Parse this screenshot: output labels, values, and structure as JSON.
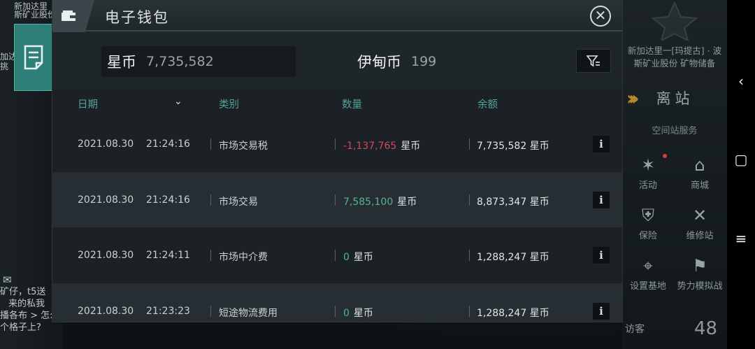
{
  "background": {
    "left_texts": [
      "新加达里",
      "斯矿业股份",
      "加达",
      "挑"
    ],
    "station": {
      "name_line1": "新加达里一[玛提古] · 波",
      "name_line2": "斯矿业股份 矿物储备",
      "undock_label": "离站",
      "services_title": "空间站服务",
      "services": [
        {
          "label": "活动",
          "icon": "party-popper-icon"
        },
        {
          "label": "商城",
          "icon": "shop-icon"
        },
        {
          "label": "保险",
          "icon": "insurance-icon"
        },
        {
          "label": "维修站",
          "icon": "repair-icon"
        },
        {
          "label": "设置基地",
          "icon": "base-icon"
        },
        {
          "label": "势力模拟战",
          "icon": "faction-battle-icon"
        }
      ],
      "visitor_label": "访客",
      "visitor_count": "48"
    },
    "chat": {
      "line1": "矿仔，t5送",
      "line2": "来的私我",
      "line3": "播各布 > 怎么就吧炮放在一起，无人",
      "line4": "个格子上?"
    }
  },
  "wallet": {
    "title": "电子钱包",
    "balances": {
      "star_label": "星币",
      "star_value": "7,735,582",
      "isk_label": "伊甸币",
      "isk_value": "199"
    },
    "columns": {
      "date": "日期",
      "category": "类别",
      "amount": "数量",
      "balance": "余额"
    },
    "transactions": [
      {
        "date": "2021.08.30",
        "time": "21:24:16",
        "category": "市场交易税",
        "amount": "-1,137,765",
        "amount_unit": "星币",
        "balance": "7,735,582 星币",
        "sign": "neg"
      },
      {
        "date": "2021.08.30",
        "time": "21:24:16",
        "category": "市场交易",
        "amount": "7,585,100",
        "amount_unit": "星币",
        "balance": "8,873,347 星币",
        "sign": "pos"
      },
      {
        "date": "2021.08.30",
        "time": "21:24:11",
        "category": "市场中介费",
        "amount": "0",
        "amount_unit": "星币",
        "balance": "1,288,247 星币",
        "sign": "pos"
      },
      {
        "date": "2021.08.30",
        "time": "21:23:23",
        "category": "短途物流费用",
        "amount": "0",
        "amount_unit": "星币",
        "balance": "1,288,247 星币",
        "sign": "pos"
      }
    ],
    "info_label": "i"
  },
  "colors": {
    "accent_teal": "#54b393",
    "negative_red": "#d3475f",
    "header_teal": "#53a19a",
    "side_button": "#2f7f79"
  }
}
